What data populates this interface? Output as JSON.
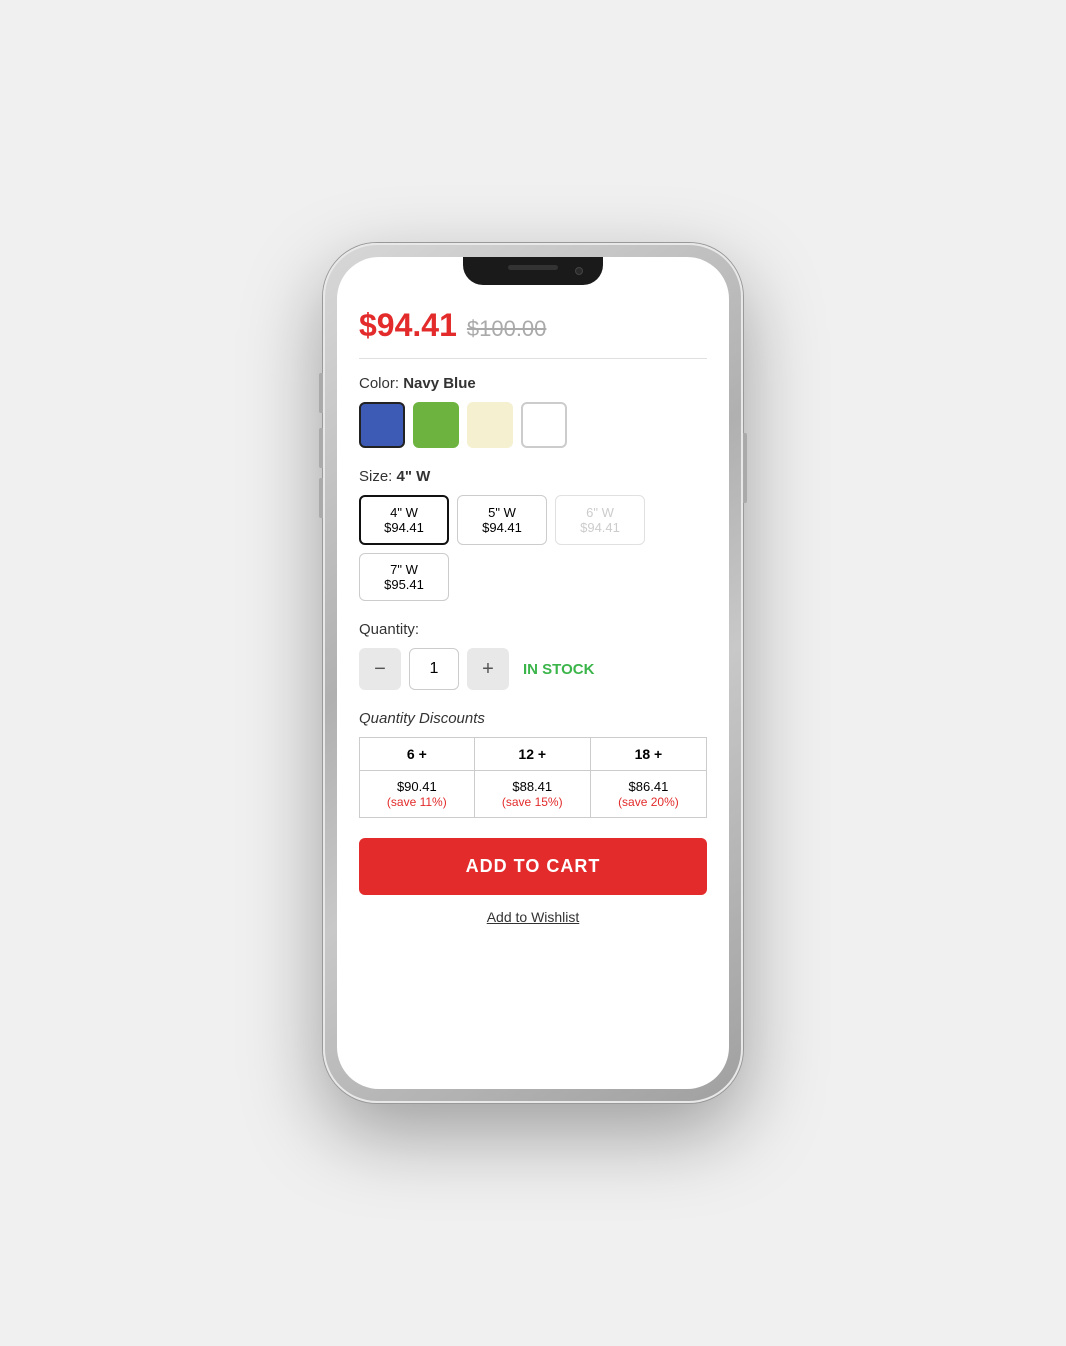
{
  "price": {
    "current": "$94.41",
    "original": "$100.00"
  },
  "color": {
    "label": "Color:",
    "selected": "Navy Blue",
    "swatches": [
      {
        "name": "Navy Blue",
        "hex": "#3d5ab5",
        "selected": true
      },
      {
        "name": "Green",
        "hex": "#6db33f",
        "selected": false
      },
      {
        "name": "Cream",
        "hex": "#f5f0d0",
        "selected": false
      },
      {
        "name": "White",
        "hex": "#ffffff",
        "selected": false
      }
    ]
  },
  "size": {
    "label": "Size:",
    "selected": "4\" W",
    "options": [
      {
        "name": "4\" W",
        "price": "$94.41",
        "selected": true,
        "disabled": false
      },
      {
        "name": "5\" W",
        "price": "$94.41",
        "selected": false,
        "disabled": false
      },
      {
        "name": "6\" W",
        "price": "$94.41",
        "selected": false,
        "disabled": true
      },
      {
        "name": "7\" W",
        "price": "$95.41",
        "selected": false,
        "disabled": false
      }
    ]
  },
  "quantity": {
    "label": "Quantity:",
    "value": "1",
    "stock_status": "IN STOCK",
    "minus_label": "−",
    "plus_label": "+"
  },
  "discounts": {
    "label": "Quantity Discounts",
    "tiers": [
      {
        "qty": "6 +",
        "price": "$90.41",
        "save": "(save 11%)"
      },
      {
        "qty": "12 +",
        "price": "$88.41",
        "save": "(save 15%)"
      },
      {
        "qty": "18 +",
        "price": "$86.41",
        "save": "(save 20%)"
      }
    ]
  },
  "add_to_cart": {
    "label": "ADD TO CART"
  },
  "wishlist": {
    "label": "Add to Wishlist"
  }
}
